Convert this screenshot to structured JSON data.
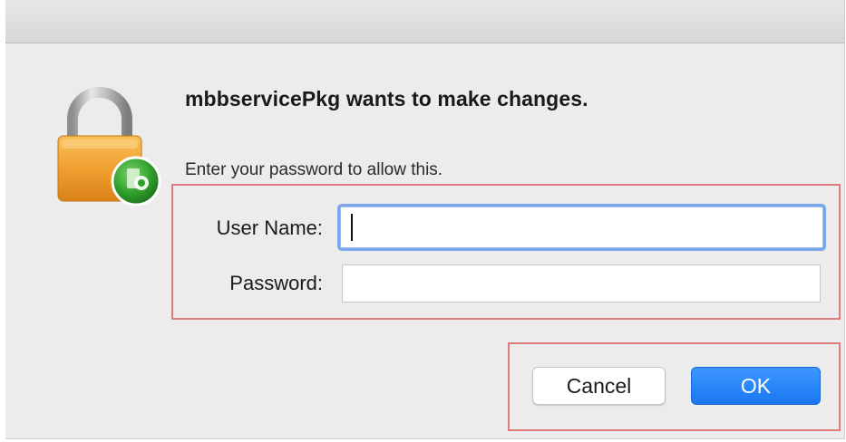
{
  "dialog": {
    "title": "mbbservicePkg wants to make changes.",
    "message": "Enter your password to allow this.",
    "icon": "lock-icon"
  },
  "fields": {
    "username": {
      "label": "User Name:",
      "value": "",
      "placeholder": ""
    },
    "password": {
      "label": "Password:",
      "value": "",
      "placeholder": ""
    }
  },
  "buttons": {
    "cancel_label": "Cancel",
    "ok_label": "OK"
  },
  "colors": {
    "accent": "#1a77f2",
    "highlight_box": "#e07a80",
    "lock_body": "#f0a030",
    "lock_badge": "#2e9e2a"
  }
}
